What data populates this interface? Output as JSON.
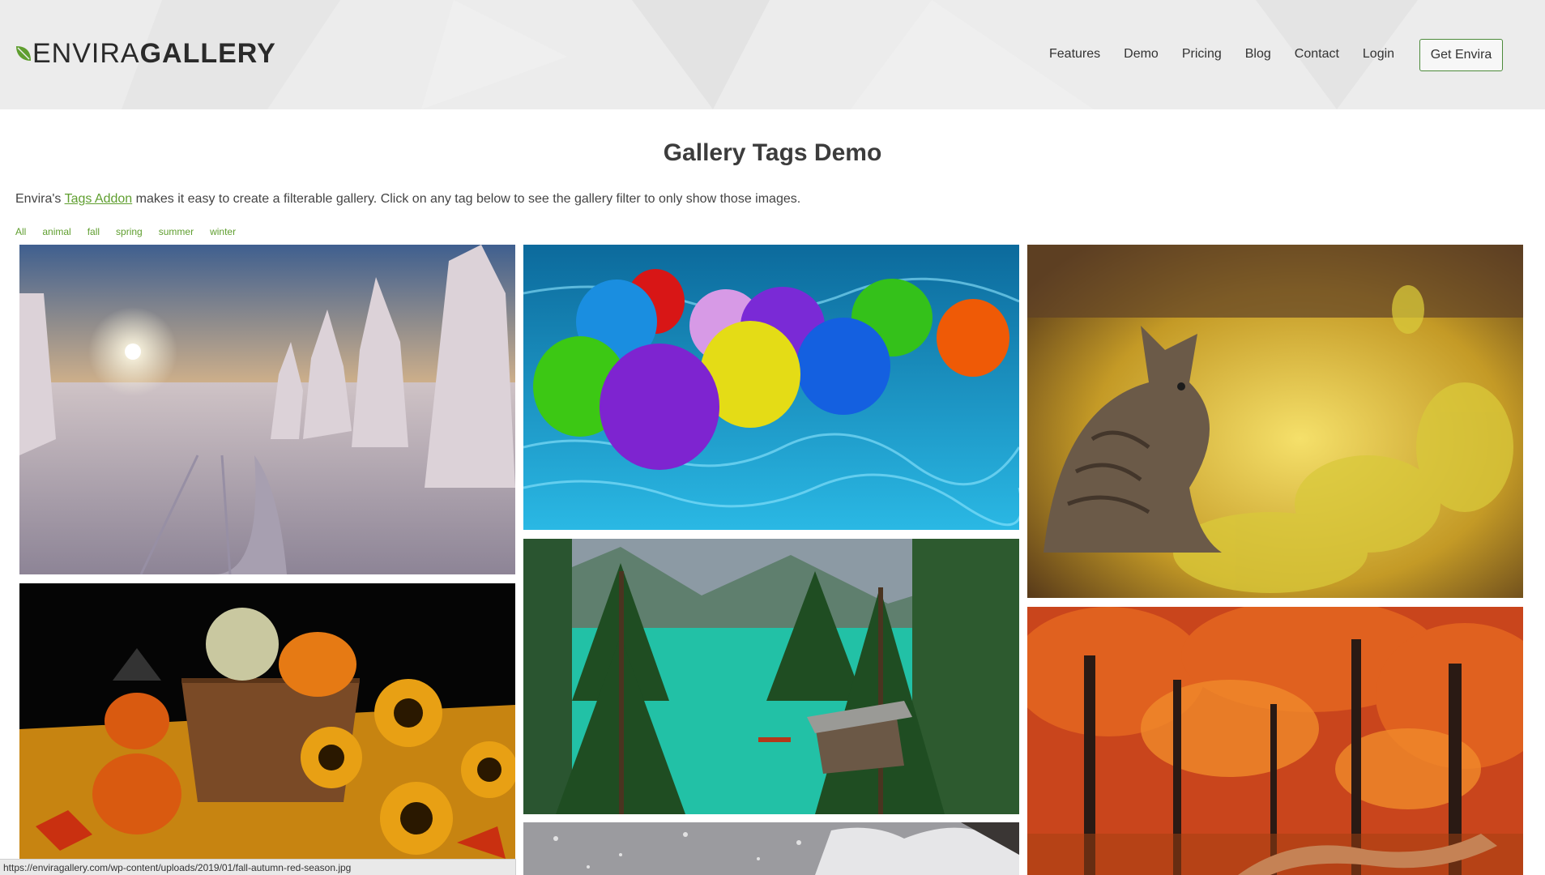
{
  "brand": {
    "logo_part1": "ENVIRA",
    "logo_part2": "GALLERY",
    "leaf_color": "#5f9e2f"
  },
  "nav": {
    "items": [
      "Features",
      "Demo",
      "Pricing",
      "Blog",
      "Contact",
      "Login"
    ],
    "cta_label": "Get Envira"
  },
  "page": {
    "title": "Gallery Tags Demo",
    "intro_prefix": "Envira's ",
    "intro_link": "Tags Addon",
    "intro_suffix": " makes it easy to create a filterable gallery. Click on any tag below to see the gallery filter to only show those images."
  },
  "tags": [
    "All",
    "animal",
    "fall",
    "spring",
    "summer",
    "winter"
  ],
  "gallery": {
    "images": [
      {
        "subject": "winter-snow-forest-sunset"
      },
      {
        "subject": "balloons-in-pool"
      },
      {
        "subject": "kitten-in-yellow-meadow"
      },
      {
        "subject": "halloween-pumpkins-sunflowers"
      },
      {
        "subject": "mountain-lake-turquoise"
      },
      {
        "subject": "autumn-red-forest"
      },
      {
        "subject": "snowy-winter-scene"
      }
    ]
  },
  "status_bar": {
    "url": "https://enviragallery.com/wp-content/uploads/2019/01/fall-autumn-red-season.jpg"
  },
  "colors": {
    "accent_green": "#5f9e2f",
    "header_bg": "#ececec",
    "text_dark": "#333333"
  }
}
